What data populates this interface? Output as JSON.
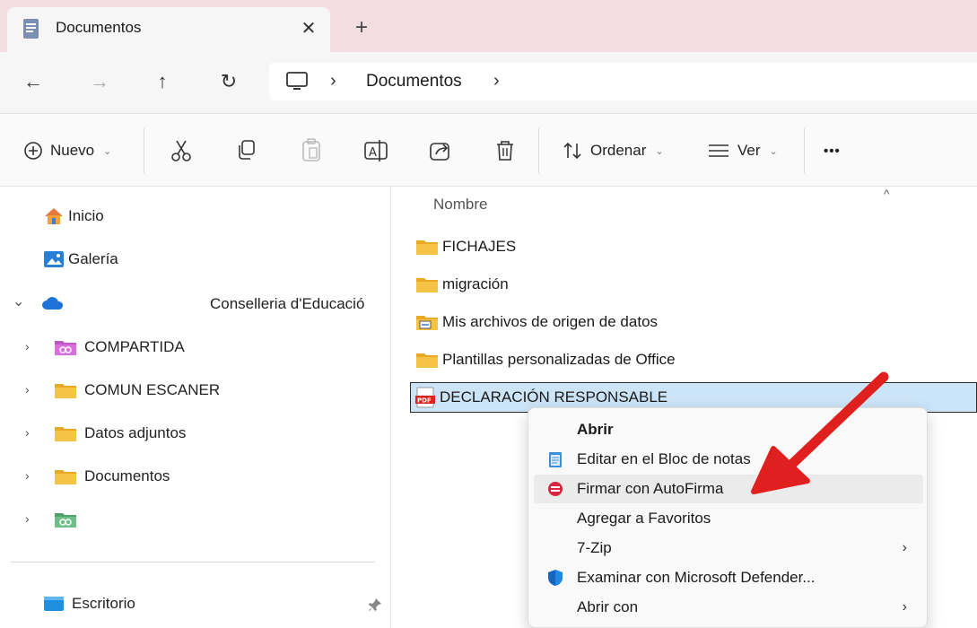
{
  "tab": {
    "title": "Documentos",
    "close": "✕",
    "new_tab": "+"
  },
  "nav": {
    "back": "←",
    "forward": "→",
    "up": "↑",
    "refresh": "↻",
    "breadcrumb_sep1": "›",
    "breadcrumb": "Documentos",
    "breadcrumb_sep2": "›"
  },
  "toolbar": {
    "new_label": "Nuevo",
    "sort_label": "Ordenar",
    "view_label": "Ver",
    "more": "•••",
    "dropdown": "⌄"
  },
  "sidebar": {
    "home": "Inicio",
    "gallery": "Galería",
    "onedrive": "Conselleria d'Educació",
    "items": [
      {
        "label": "COMPARTIDA",
        "icon": "shared-folder-icon"
      },
      {
        "label": "COMUN ESCANER",
        "icon": "folder-icon"
      },
      {
        "label": "Datos adjuntos",
        "icon": "folder-icon"
      },
      {
        "label": "Documentos",
        "icon": "folder-icon"
      },
      {
        "label": "",
        "icon": "shared-folder-icon"
      }
    ],
    "desktop": "Escritorio",
    "expand_glyph": "›",
    "collapse_glyph": "⌄"
  },
  "files": {
    "column_name": "Nombre",
    "sort_caret": "^",
    "rows": [
      {
        "name": "FICHAJES",
        "icon": "folder-icon"
      },
      {
        "name": "migración",
        "icon": "folder-icon"
      },
      {
        "name": "Mis archivos de origen de datos",
        "icon": "data-source-folder-icon"
      },
      {
        "name": "Plantillas personalizadas de Office",
        "icon": "folder-icon"
      },
      {
        "name": "DECLARACIÓN RESPONSABLE",
        "icon": "pdf-icon",
        "selected": true
      }
    ]
  },
  "context_menu": {
    "items": [
      {
        "label": "Abrir",
        "bold": true
      },
      {
        "label": "Editar en el Bloc de notas",
        "icon": "notepad-icon"
      },
      {
        "label": "Firmar con AutoFirma",
        "icon": "autofirma-icon",
        "hover": true
      },
      {
        "label": "Agregar a Favoritos"
      },
      {
        "label": "7-Zip",
        "submenu": true
      },
      {
        "label": "Examinar con Microsoft Defender...",
        "icon": "defender-shield-icon"
      },
      {
        "label": "Abrir con",
        "submenu": true
      }
    ],
    "submenu_glyph": "›"
  },
  "colors": {
    "folder": "#f4c244",
    "selection": "#cce4f7",
    "arrow": "#e0201e",
    "tabstrip": "#f3dde2",
    "onedrive": "#1e73d8"
  }
}
